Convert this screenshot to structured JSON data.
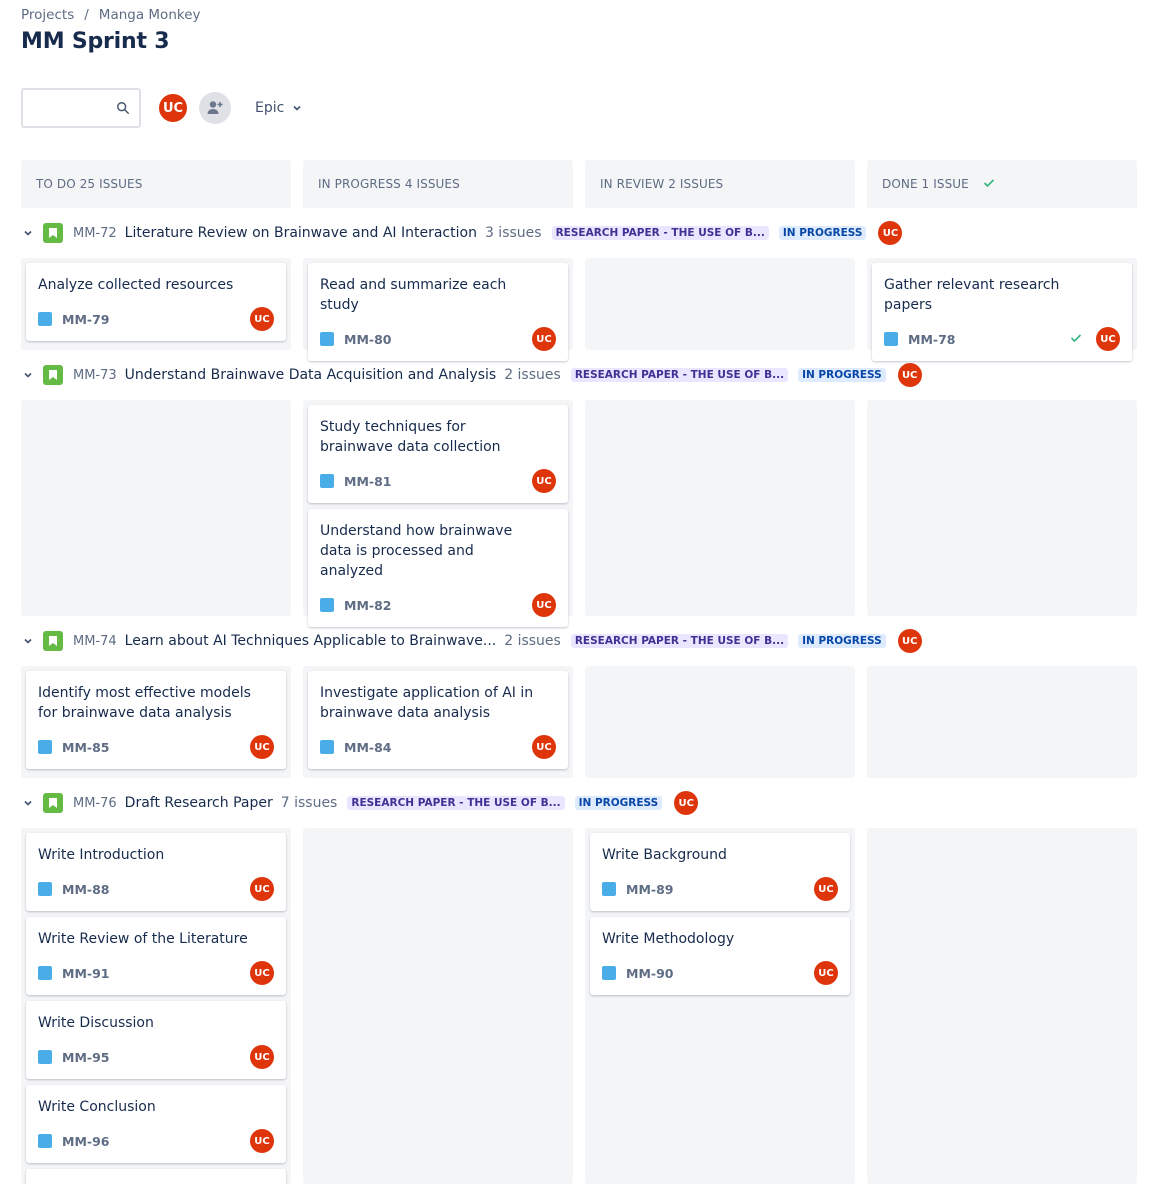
{
  "breadcrumb": {
    "projects": "Projects",
    "separator": "/",
    "project": "Manga Monkey"
  },
  "title": "MM Sprint 3",
  "toolbar": {
    "search_placeholder": "",
    "avatar_initials": "UC",
    "epic_label": "Epic"
  },
  "columns": [
    {
      "label": "TO DO 25 ISSUES"
    },
    {
      "label": "IN PROGRESS 4 ISSUES"
    },
    {
      "label": "IN REVIEW 2 ISSUES"
    },
    {
      "label": "DONE 1 ISSUE"
    }
  ],
  "swimlanes": [
    {
      "key": "MM-72",
      "title": "Literature Review on Brainwave and AI Interaction",
      "count": "3 issues",
      "epic": "RESEARCH PAPER - THE USE OF B...",
      "status": "IN PROGRESS",
      "avatar": "UC"
    },
    {
      "key": "MM-73",
      "title": "Understand Brainwave Data Acquisition and Analysis",
      "count": "2 issues",
      "epic": "RESEARCH PAPER - THE USE OF B...",
      "status": "IN PROGRESS",
      "avatar": "UC"
    },
    {
      "key": "MM-74",
      "title": "Learn about AI Techniques Applicable to Brainwave...",
      "count": "2 issues",
      "epic": "RESEARCH PAPER - THE USE OF B...",
      "status": "IN PROGRESS",
      "avatar": "UC"
    },
    {
      "key": "MM-76",
      "title": "Draft Research Paper",
      "count": "7 issues",
      "epic": "RESEARCH PAPER - THE USE OF B...",
      "status": "IN PROGRESS",
      "avatar": "UC"
    }
  ],
  "cards": {
    "mm79": {
      "title": "Analyze collected resources",
      "key": "MM-79",
      "avatar": "UC"
    },
    "mm80": {
      "title": "Read and summarize each study",
      "key": "MM-80",
      "avatar": "UC"
    },
    "mm78": {
      "title": "Gather relevant research papers",
      "key": "MM-78",
      "avatar": "UC",
      "done_icon": "check-icon"
    },
    "mm81": {
      "title": "Study techniques for brainwave data collection",
      "key": "MM-81",
      "avatar": "UC"
    },
    "mm82": {
      "title": "Understand how brainwave data is processed and analyzed",
      "key": "MM-82",
      "avatar": "UC"
    },
    "mm85": {
      "title": "Identify most effective models for brainwave data analysis",
      "key": "MM-85",
      "avatar": "UC"
    },
    "mm84": {
      "title": "Investigate application of AI in brainwave data analysis",
      "key": "MM-84",
      "avatar": "UC"
    },
    "mm88": {
      "title": "Write Introduction",
      "key": "MM-88",
      "avatar": "UC"
    },
    "mm91": {
      "title": "Write Review of the Literature",
      "key": "MM-91",
      "avatar": "UC"
    },
    "mm95": {
      "title": "Write Discussion",
      "key": "MM-95",
      "avatar": "UC"
    },
    "mm96": {
      "title": "Write Conclusion",
      "key": "MM-96",
      "avatar": "UC"
    },
    "mm89": {
      "title": "Write Background",
      "key": "MM-89",
      "avatar": "UC"
    },
    "mm90": {
      "title": "Write Methodology",
      "key": "MM-90",
      "avatar": "UC"
    }
  },
  "colors": {
    "avatar": "#de350b",
    "epic_icon": "#65ba43",
    "task_icon": "#4bade8",
    "column_bg": "#f4f5f7",
    "epic_lozenge_bg": "#eae6ff",
    "status_lozenge_bg": "#deebff"
  }
}
